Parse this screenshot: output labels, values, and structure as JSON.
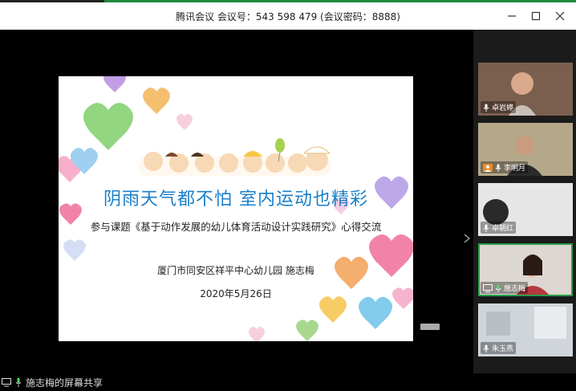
{
  "window": {
    "title": "腾讯会议  会议号：543 598 479  (会议密码：8888)"
  },
  "slide": {
    "title": "阴雨天气都不怕  室内运动也精彩",
    "subtitle": "参与课题《基于动作发展的幼儿体育活动设计实践研究》心得交流",
    "school": "厦门市同安区祥平中心幼儿园   施志梅",
    "date": "2020年5月26日"
  },
  "participants": [
    {
      "name": "卓岩婷",
      "bg": "#8a6b58"
    },
    {
      "name": "李明月",
      "bg": "#b8a888"
    },
    {
      "name": "卓朝红",
      "bg": "#e4e4e4"
    },
    {
      "name": "施志梅",
      "bg": "#d8d2cc"
    },
    {
      "name": "朱玉燕",
      "bg": "#cfd6dc"
    }
  ],
  "status": {
    "share_text": "施志梅的屏幕共享"
  },
  "colors": {
    "accent": "#1e8a3c",
    "slide_title": "#1a7fc9",
    "active_border": "#2a9d4a"
  }
}
